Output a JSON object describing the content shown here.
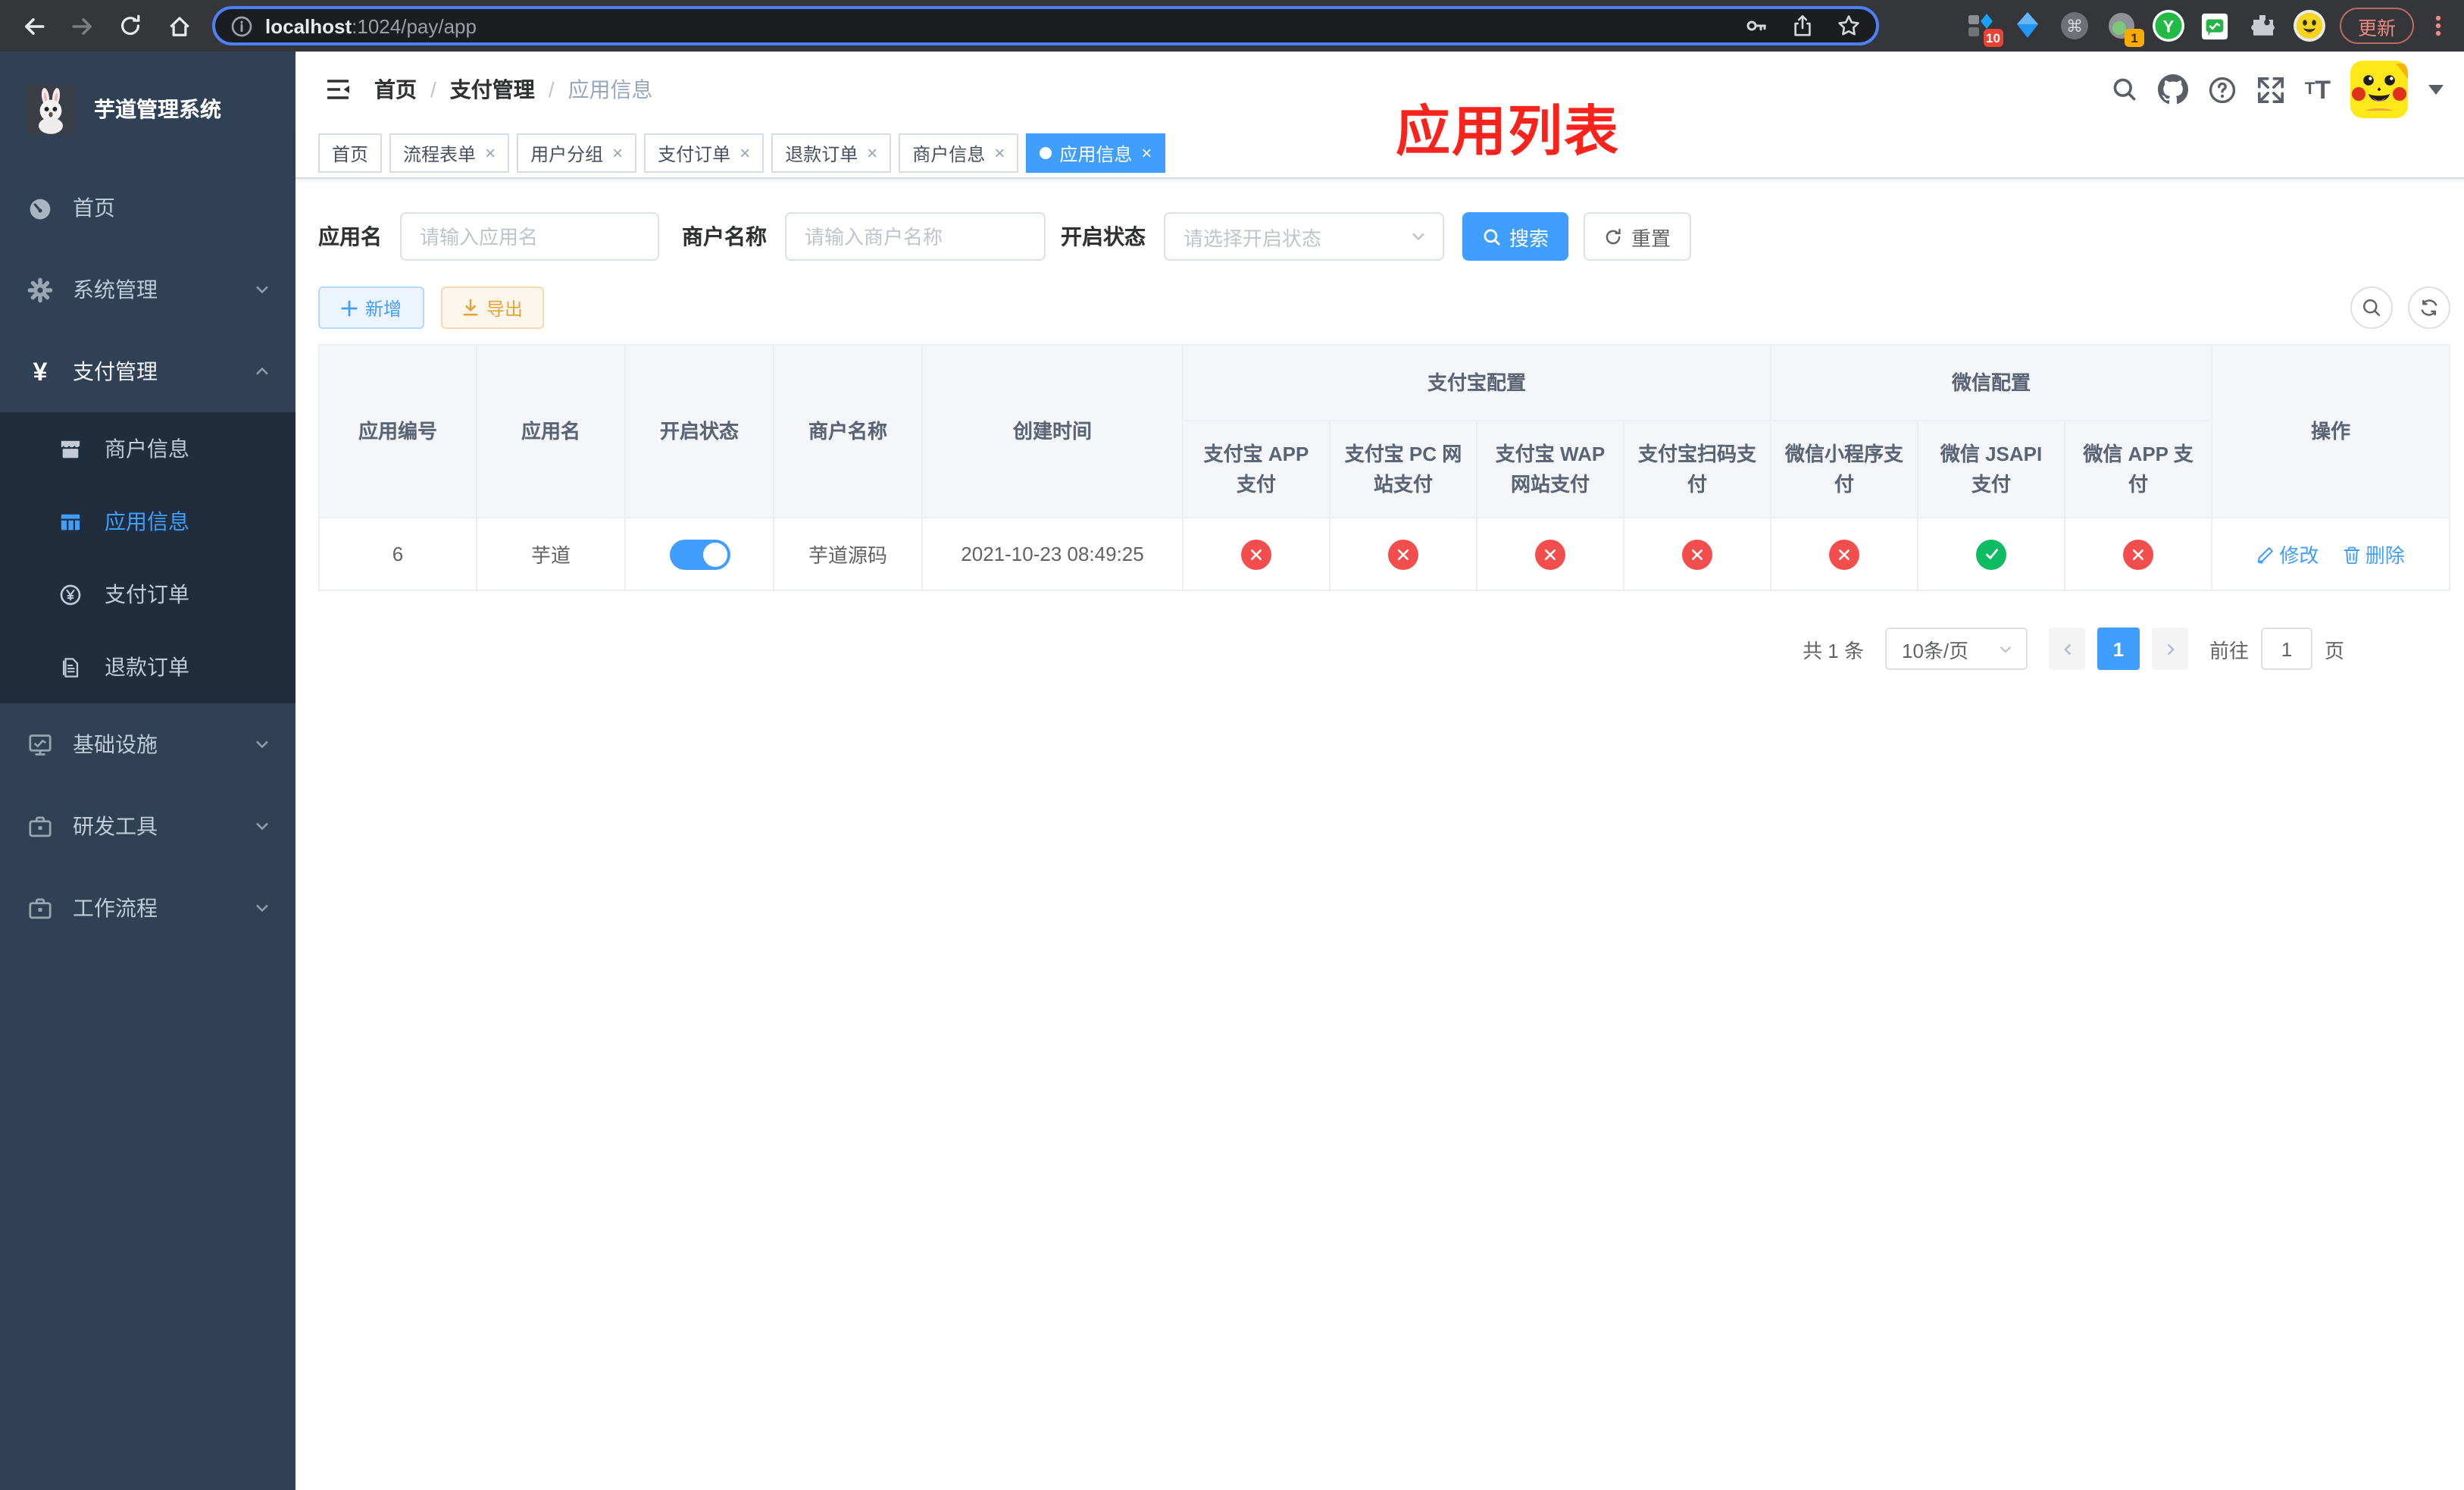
{
  "colors": {
    "primary": "#409eff",
    "success": "#0dbc60",
    "danger": "#f34d4d",
    "warning": "#e6a23c",
    "title_red": "#f7231c",
    "sidebar_bg": "#304156",
    "submenu_bg": "#1f2d3d"
  },
  "browser": {
    "url_host": "localhost",
    "url_rest": ":1024/pay/app",
    "update_button": "更新",
    "ext_badge_1": "10",
    "ext_badge_2": "1"
  },
  "sidebar": {
    "logo_title": "芋道管理系统",
    "items": [
      {
        "label": "首页"
      },
      {
        "label": "系统管理"
      },
      {
        "label": "支付管理"
      },
      {
        "label": "基础设施"
      },
      {
        "label": "研发工具"
      },
      {
        "label": "工作流程"
      }
    ],
    "pay_submenu": [
      {
        "label": "商户信息"
      },
      {
        "label": "应用信息"
      },
      {
        "label": "支付订单"
      },
      {
        "label": "退款订单"
      }
    ]
  },
  "navbar": {
    "breadcrumb": [
      "首页",
      "支付管理",
      "应用信息"
    ],
    "overlay_title": "应用列表"
  },
  "tags_view": [
    {
      "label": "首页",
      "closable": false,
      "active": false
    },
    {
      "label": "流程表单",
      "closable": true,
      "active": false
    },
    {
      "label": "用户分组",
      "closable": true,
      "active": false
    },
    {
      "label": "支付订单",
      "closable": true,
      "active": false
    },
    {
      "label": "退款订单",
      "closable": true,
      "active": false
    },
    {
      "label": "商户信息",
      "closable": true,
      "active": false
    },
    {
      "label": "应用信息",
      "closable": true,
      "active": true
    }
  ],
  "filters": {
    "app_name_label": "应用名",
    "app_name_placeholder": "请输入应用名",
    "merchant_label": "商户名称",
    "merchant_placeholder": "请输入商户名称",
    "status_label": "开启状态",
    "status_placeholder": "请选择开启状态",
    "search_button": "搜索",
    "reset_button": "重置"
  },
  "toolbar": {
    "add_button": "新增",
    "export_button": "导出"
  },
  "table": {
    "columns": [
      "应用编号",
      "应用名",
      "开启状态",
      "商户名称",
      "创建时间"
    ],
    "group_alipay": "支付宝配置",
    "group_wechat": "微信配置",
    "alipay_columns": [
      "支付宝 APP 支付",
      "支付宝 PC 网站支付",
      "支付宝 WAP 网站支付",
      "支付宝扫码支付"
    ],
    "wechat_columns": [
      "微信小程序支付",
      "微信 JSAPI 支付",
      "微信 APP 支付"
    ],
    "actions_column": "操作",
    "row": {
      "id": "6",
      "app_name": "芋道",
      "enabled": true,
      "merchant": "芋道源码",
      "created_at": "2021-10-23 08:49:25",
      "statuses": [
        false,
        false,
        false,
        false,
        false,
        true,
        false
      ],
      "edit_label": "修改",
      "delete_label": "删除"
    }
  },
  "pagination": {
    "total_label": "共 1 条",
    "page_size": "10条/页",
    "current_page": "1",
    "goto_label": "前往",
    "goto_value": "1",
    "page_label": "页"
  }
}
